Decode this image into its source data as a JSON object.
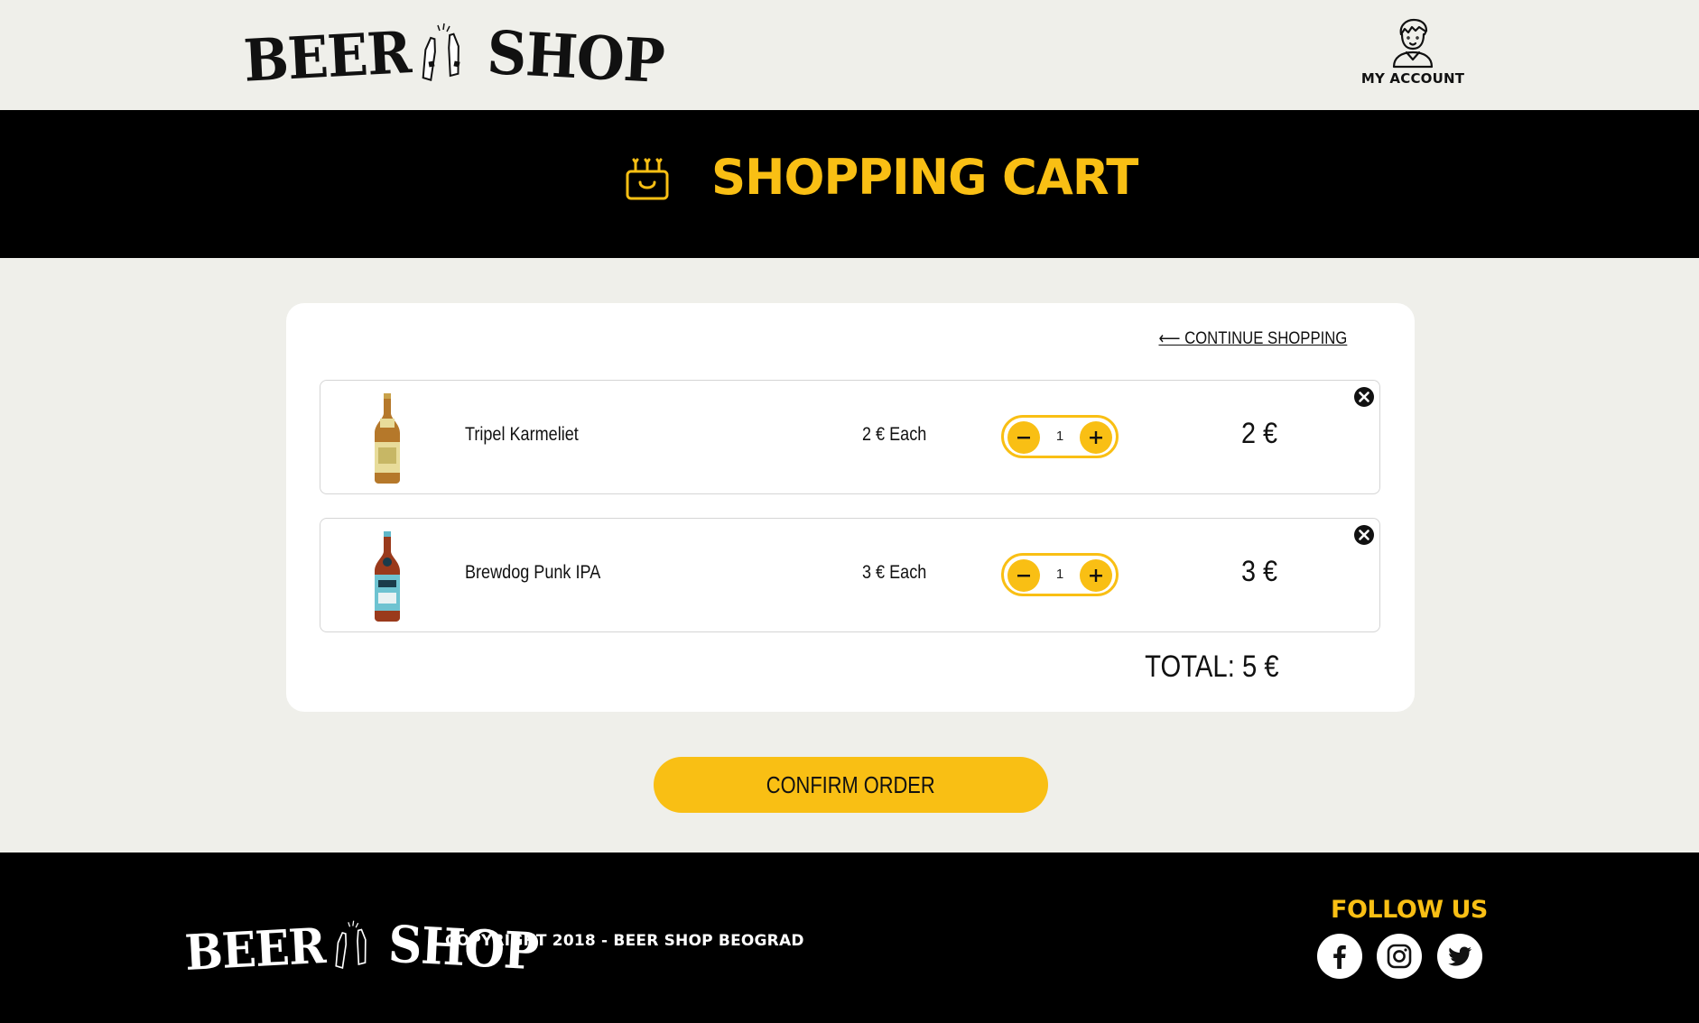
{
  "header": {
    "logo_word1": "BEER",
    "logo_word2": "SHOP",
    "account_label": "MY ACCOUNT"
  },
  "banner": {
    "title": "SHOPPING CART"
  },
  "cart": {
    "continue_label": "⟵ CONTINUE SHOPPING",
    "items": [
      {
        "name": "Tripel Karmeliet",
        "each": "2 € Each",
        "qty": "1",
        "total": "2 €"
      },
      {
        "name": "Brewdog Punk IPA",
        "each": "3 € Each",
        "qty": "1",
        "total": "3 €"
      }
    ],
    "total": "TOTAL: 5 €"
  },
  "confirm_label": "CONFIRM ORDER",
  "footer": {
    "logo_word1": "BEER",
    "logo_word2": "SHOP",
    "copyright": "COPYRIGHT 2018 - BEER SHOP BEOGRAD",
    "follow": "FOLLOW US"
  },
  "icons": [
    "bottles-icon",
    "user-icon",
    "cart-icon",
    "minus-icon",
    "plus-icon",
    "close-icon",
    "facebook-icon",
    "instagram-icon",
    "twitter-icon"
  ],
  "colors": {
    "accent": "#f9bf14",
    "background": "#efefea",
    "dark": "#000000"
  }
}
